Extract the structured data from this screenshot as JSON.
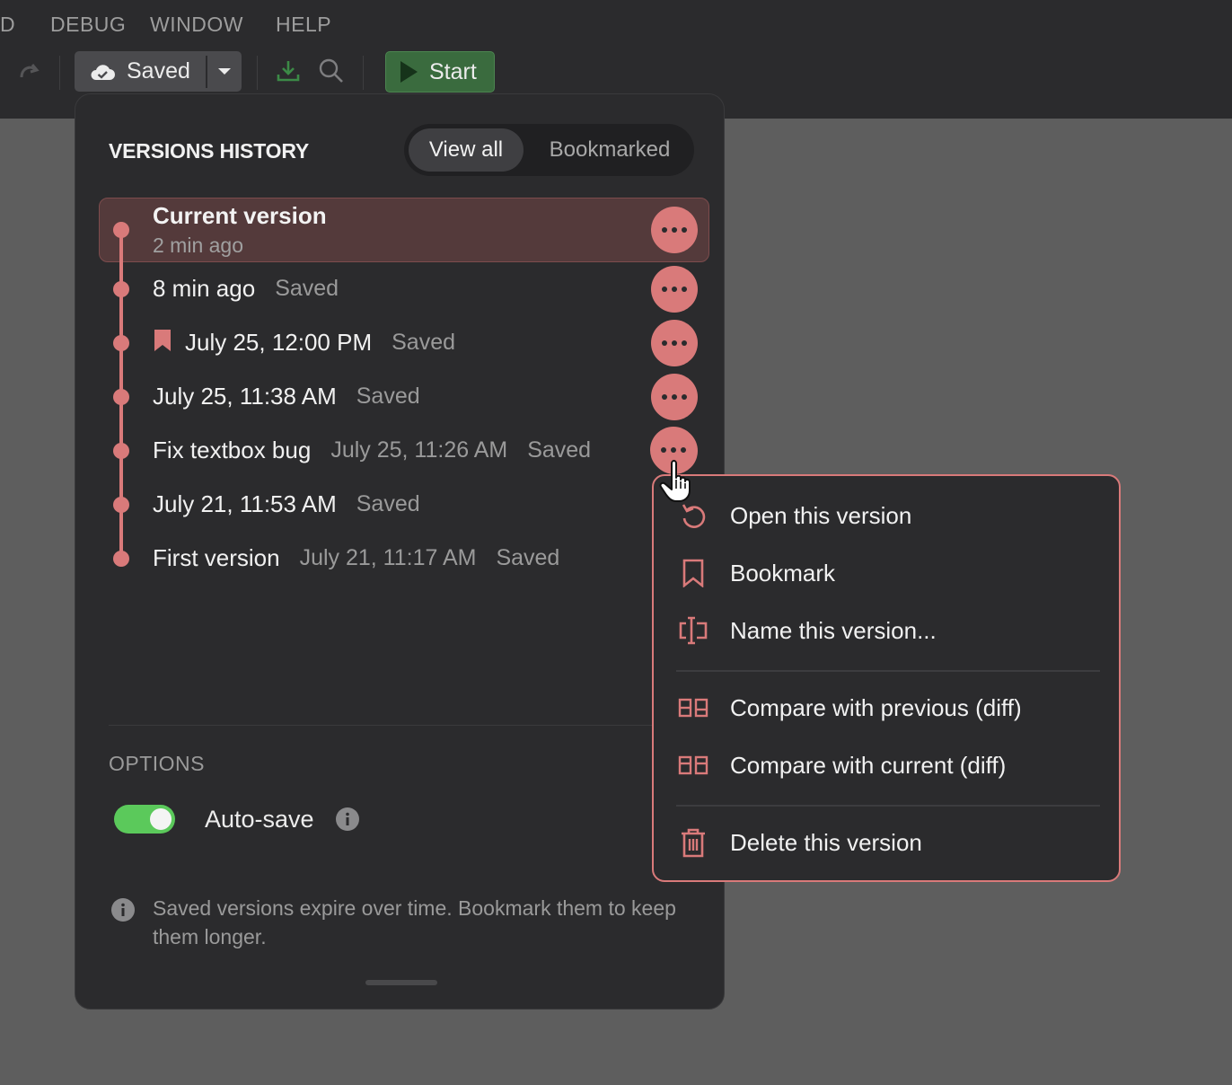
{
  "menubar": {
    "items": [
      "D",
      "DEBUG",
      "WINDOW",
      "HELP"
    ]
  },
  "toolbar": {
    "saved_label": "Saved",
    "start_label": "Start"
  },
  "versions_panel": {
    "title": "VERSIONS HISTORY",
    "tabs": [
      {
        "label": "View all",
        "active": true
      },
      {
        "label": "Bookmarked",
        "active": false
      }
    ],
    "current": {
      "title": "Current version",
      "time": "2 min ago"
    },
    "versions": [
      {
        "name": "8 min ago",
        "date": "",
        "status": "Saved",
        "bookmarked": false
      },
      {
        "name": "July 25, 12:00 PM",
        "date": "",
        "status": "Saved",
        "bookmarked": true
      },
      {
        "name": "July 25, 11:38 AM",
        "date": "",
        "status": "Saved",
        "bookmarked": false
      },
      {
        "name": "Fix textbox bug",
        "date": "July 25, 11:26 AM",
        "status": "Saved",
        "bookmarked": false
      },
      {
        "name": "July 21, 11:53 AM",
        "date": "",
        "status": "Saved",
        "bookmarked": false
      },
      {
        "name": "First version",
        "date": "July 21, 11:17 AM",
        "status": "Saved",
        "bookmarked": false
      }
    ],
    "options_title": "OPTIONS",
    "autosave_label": "Auto-save",
    "autosave_on": true,
    "footnote": "Saved versions expire over time. Bookmark them to keep them longer."
  },
  "context_menu": {
    "items": [
      {
        "label": "Open this version",
        "icon": "restore-icon"
      },
      {
        "label": "Bookmark",
        "icon": "bookmark-icon"
      },
      {
        "label": "Name this version...",
        "icon": "rename-icon"
      },
      {
        "label": "Compare with previous (diff)",
        "icon": "compare-icon"
      },
      {
        "label": "Compare with current (diff)",
        "icon": "compare-icon"
      },
      {
        "label": "Delete this version",
        "icon": "trash-icon"
      }
    ]
  },
  "colors": {
    "accent": "#d97a7a",
    "toggle_on": "#5bc95b",
    "start_bg": "#3a6b3e"
  }
}
